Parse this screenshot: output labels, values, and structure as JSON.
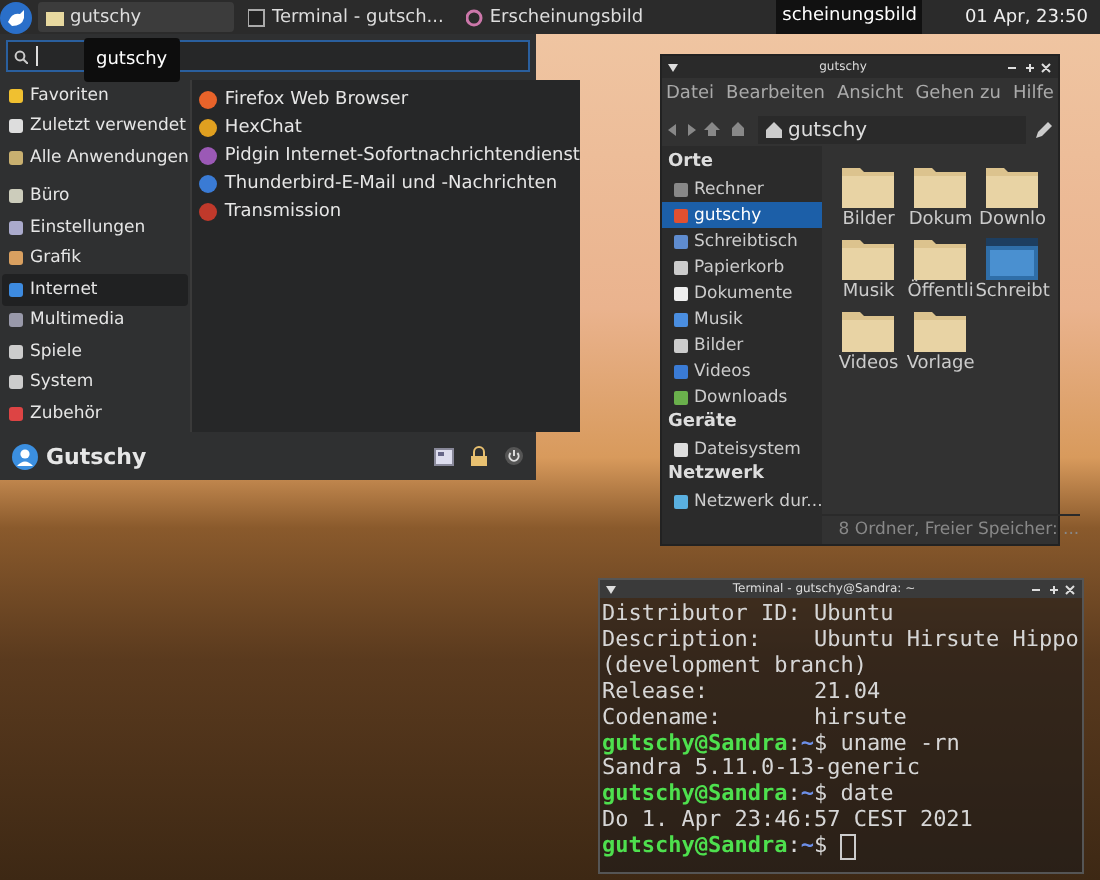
{
  "panel": {
    "tasks": [
      {
        "label": "gutschy",
        "selected": true
      },
      {
        "label": "Terminal - gutsch...",
        "selected": false
      },
      {
        "label": "Erscheinungsbild",
        "selected": false
      }
    ],
    "preview": "scheinungsbild",
    "clock": "01 Apr, 23:50"
  },
  "menu": {
    "tooltip": "gutschy",
    "category_groups": [
      {
        "items": [
          {
            "label": "Favoriten",
            "selected": false
          },
          {
            "label": "Zuletzt verwendet",
            "selected": false
          },
          {
            "label": "Alle Anwendungen",
            "selected": false
          }
        ]
      },
      {
        "items": [
          {
            "label": "Büro",
            "selected": false
          },
          {
            "label": "Einstellungen",
            "selected": false
          },
          {
            "label": "Grafik",
            "selected": false
          },
          {
            "label": "Internet",
            "selected": true
          },
          {
            "label": "Multimedia",
            "selected": false
          },
          {
            "label": "Spiele",
            "selected": false
          },
          {
            "label": "System",
            "selected": false
          },
          {
            "label": "Zubehör",
            "selected": false
          }
        ]
      }
    ],
    "apps": [
      {
        "label": "Firefox Web Browser",
        "color": "#e8632a"
      },
      {
        "label": "HexChat",
        "color": "#e0a020"
      },
      {
        "label": "Pidgin Internet-Sofortnachrichtendienst",
        "color": "#9b59b6"
      },
      {
        "label": "Thunderbird-E-Mail und -Nachrichten",
        "color": "#3a7bd5"
      },
      {
        "label": "Transmission",
        "color": "#c0392b"
      }
    ],
    "user": "Gutschy"
  },
  "file_manager": {
    "title": "gutschy",
    "menus": [
      "Datei",
      "Bearbeiten",
      "Ansicht",
      "Gehen zu",
      "Hilfe"
    ],
    "path": "gutschy",
    "sections": [
      {
        "heading": "Orte",
        "items": [
          {
            "label": "Rechner",
            "selected": false
          },
          {
            "label": "gutschy",
            "selected": true
          },
          {
            "label": "Schreibtisch",
            "selected": false
          },
          {
            "label": "Papierkorb",
            "selected": false
          },
          {
            "label": "Dokumente",
            "selected": false
          },
          {
            "label": "Musik",
            "selected": false
          },
          {
            "label": "Bilder",
            "selected": false
          },
          {
            "label": "Videos",
            "selected": false
          },
          {
            "label": "Downloads",
            "selected": false
          }
        ]
      },
      {
        "heading": "Geräte",
        "items": [
          {
            "label": "Dateisystem",
            "selected": false
          }
        ]
      },
      {
        "heading": "Netzwerk",
        "items": [
          {
            "label": "Netzwerk dur...",
            "selected": false
          }
        ]
      }
    ],
    "files": [
      {
        "label": "Bilder",
        "kind": "folder"
      },
      {
        "label": "Dokum",
        "kind": "folder"
      },
      {
        "label": "Downlo",
        "kind": "folder"
      },
      {
        "label": "Musik",
        "kind": "folder"
      },
      {
        "label": "Öffentli",
        "kind": "folder"
      },
      {
        "label": "Schreibt",
        "kind": "desktop"
      },
      {
        "label": "Videos",
        "kind": "folder"
      },
      {
        "label": "Vorlage",
        "kind": "folder"
      }
    ],
    "status": "8 Ordner, Freier Speicher: ..."
  },
  "terminal": {
    "title": "Terminal - gutschy@Sandra: ~",
    "lines": [
      {
        "kind": "output",
        "text": "Distributor ID: Ubuntu"
      },
      {
        "kind": "output",
        "text": "Description:    Ubuntu Hirsute Hippo"
      },
      {
        "kind": "output",
        "text": "(development branch)"
      },
      {
        "kind": "output",
        "text": "Release:        21.04"
      },
      {
        "kind": "output",
        "text": "Codename:       hirsute"
      },
      {
        "kind": "prompt",
        "user": "gutschy@Sandra",
        "sep": ":",
        "path": "~",
        "command": "$ uname -rn"
      },
      {
        "kind": "output",
        "text": "Sandra 5.11.0-13-generic"
      },
      {
        "kind": "prompt",
        "user": "gutschy@Sandra",
        "sep": ":",
        "path": "~",
        "command": "$ date"
      },
      {
        "kind": "output",
        "text": "Do 1. Apr 23:46:57 CEST 2021"
      },
      {
        "kind": "prompt",
        "user": "gutschy@Sandra",
        "sep": ":",
        "path": "~",
        "command": "$",
        "cursor": true
      }
    ]
  }
}
